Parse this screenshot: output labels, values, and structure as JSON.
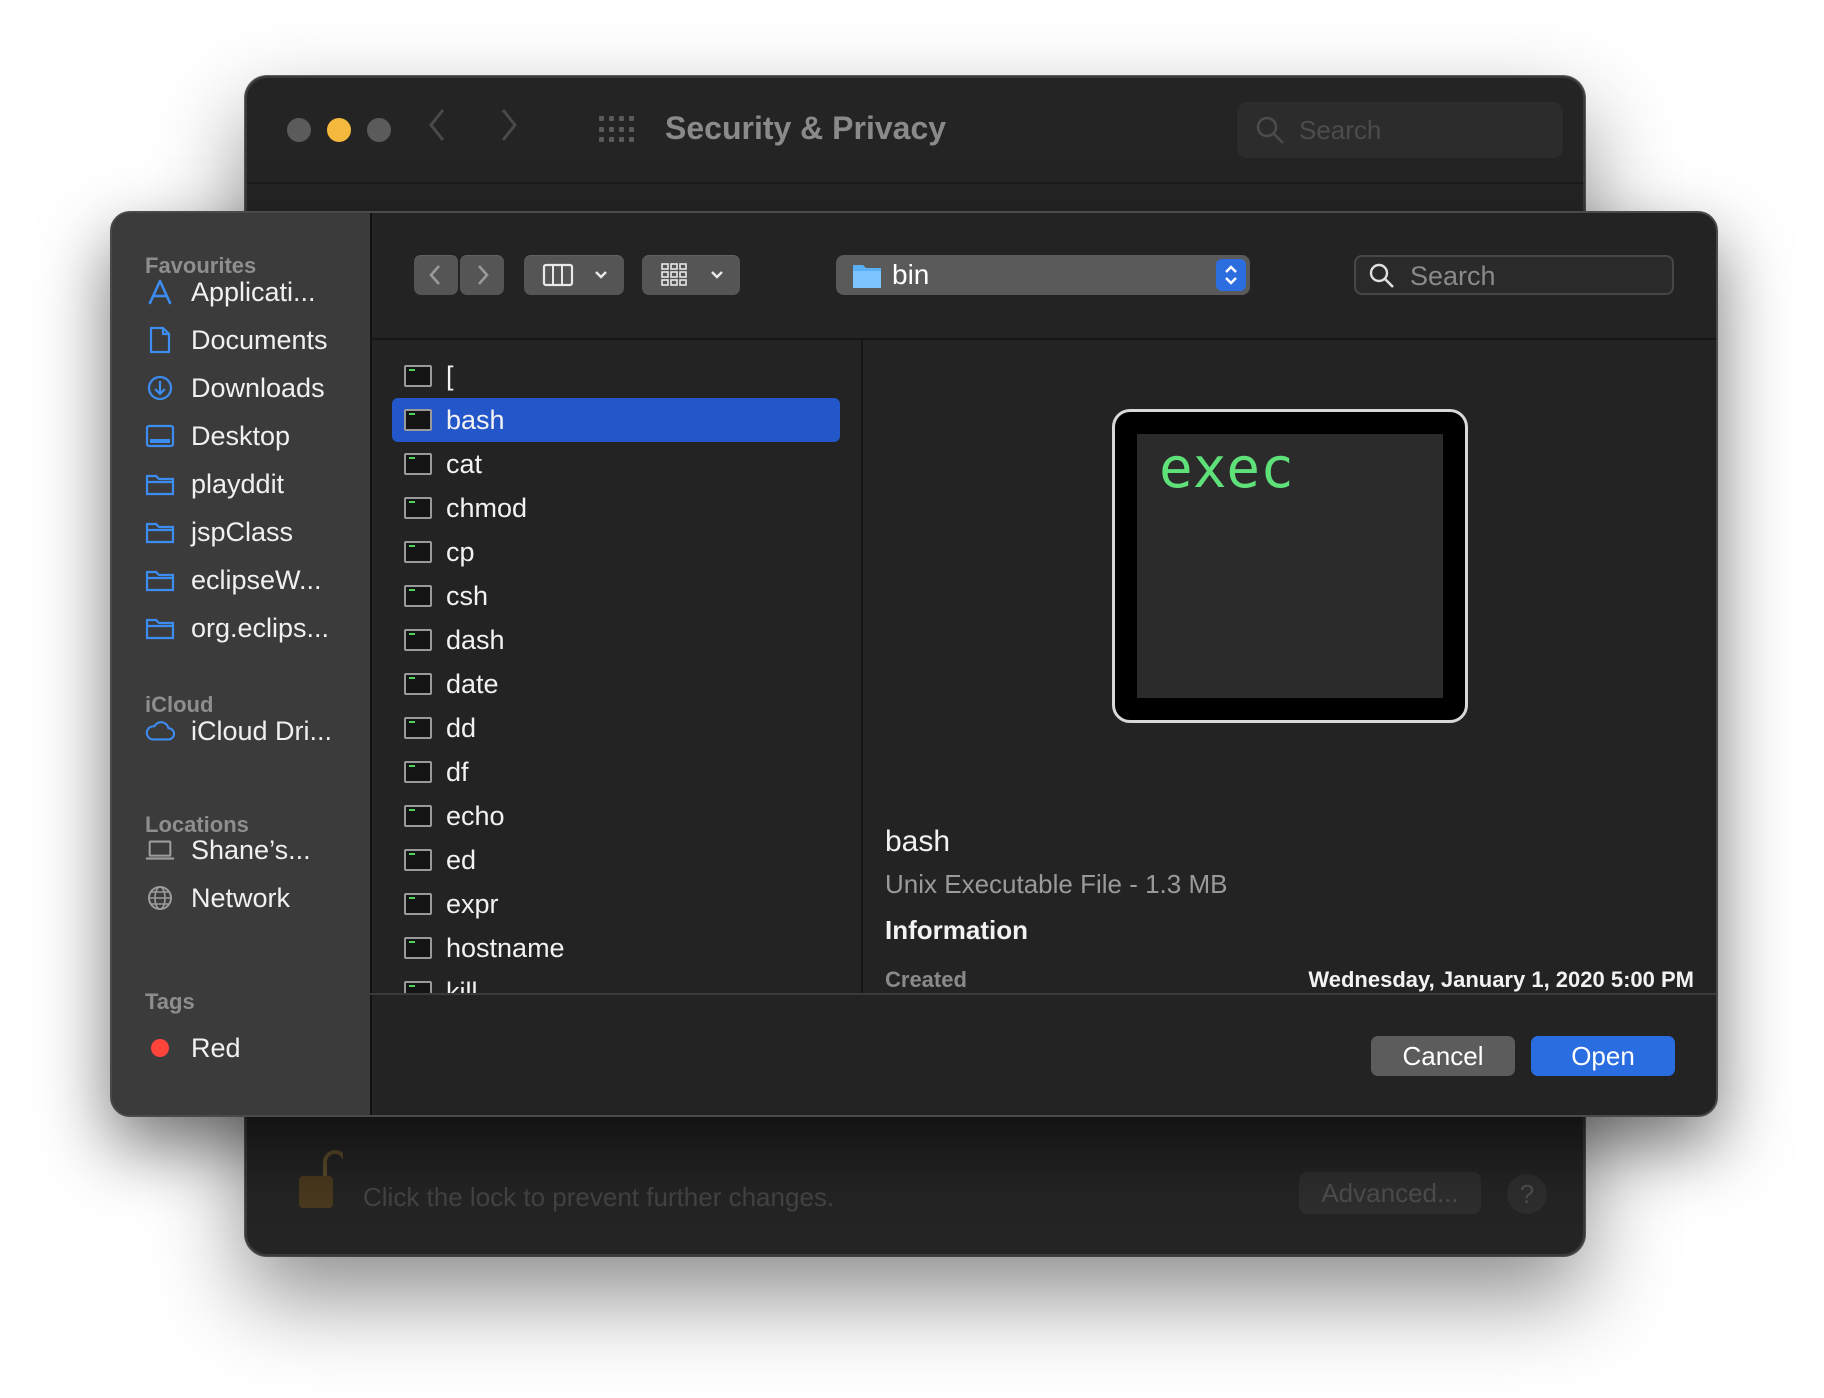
{
  "background_window": {
    "title": "Security & Privacy",
    "search_placeholder": "Search",
    "lock_text": "Click the lock to prevent further changes.",
    "advanced_label": "Advanced...",
    "help_label": "?"
  },
  "dialog": {
    "sidebar": {
      "sections": [
        {
          "title": "Favourites",
          "items": [
            {
              "label": "Applicati...",
              "icon": "applications-icon"
            },
            {
              "label": "Documents",
              "icon": "document-icon"
            },
            {
              "label": "Downloads",
              "icon": "download-icon"
            },
            {
              "label": "Desktop",
              "icon": "desktop-icon"
            },
            {
              "label": "playddit",
              "icon": "folder-icon"
            },
            {
              "label": "jspClass",
              "icon": "folder-icon"
            },
            {
              "label": "eclipseW...",
              "icon": "folder-icon"
            },
            {
              "label": "org.eclips...",
              "icon": "folder-icon"
            }
          ]
        },
        {
          "title": "iCloud",
          "items": [
            {
              "label": "iCloud Dri...",
              "icon": "cloud-icon"
            }
          ]
        },
        {
          "title": "Locations",
          "items": [
            {
              "label": "Shane’s...",
              "icon": "laptop-icon"
            },
            {
              "label": "Network",
              "icon": "globe-icon"
            }
          ]
        },
        {
          "title": "Tags",
          "items": [
            {
              "label": "Red",
              "icon": "red-tag-icon",
              "color": "#ff453a"
            }
          ]
        }
      ]
    },
    "toolbar": {
      "view_mode": "columns",
      "group_mode": "icons",
      "path": "bin",
      "search_placeholder": "Search"
    },
    "files": [
      "[",
      "bash",
      "cat",
      "chmod",
      "cp",
      "csh",
      "dash",
      "date",
      "dd",
      "df",
      "echo",
      "ed",
      "expr",
      "hostname",
      "kill"
    ],
    "selected_file": "bash",
    "preview": {
      "icon_text": "exec",
      "name": "bash",
      "kind": "Unix Executable File - 1.3 MB",
      "info_heading": "Information",
      "created_label": "Created",
      "created_value": "Wednesday, January 1, 2020 5:00 PM"
    },
    "buttons": {
      "cancel": "Cancel",
      "open": "Open"
    },
    "colors": {
      "accent": "#2a6de0",
      "selection": "#2256c9",
      "sidebar_icon": "#3d8cf0",
      "exec_text": "#5fe17a"
    }
  }
}
